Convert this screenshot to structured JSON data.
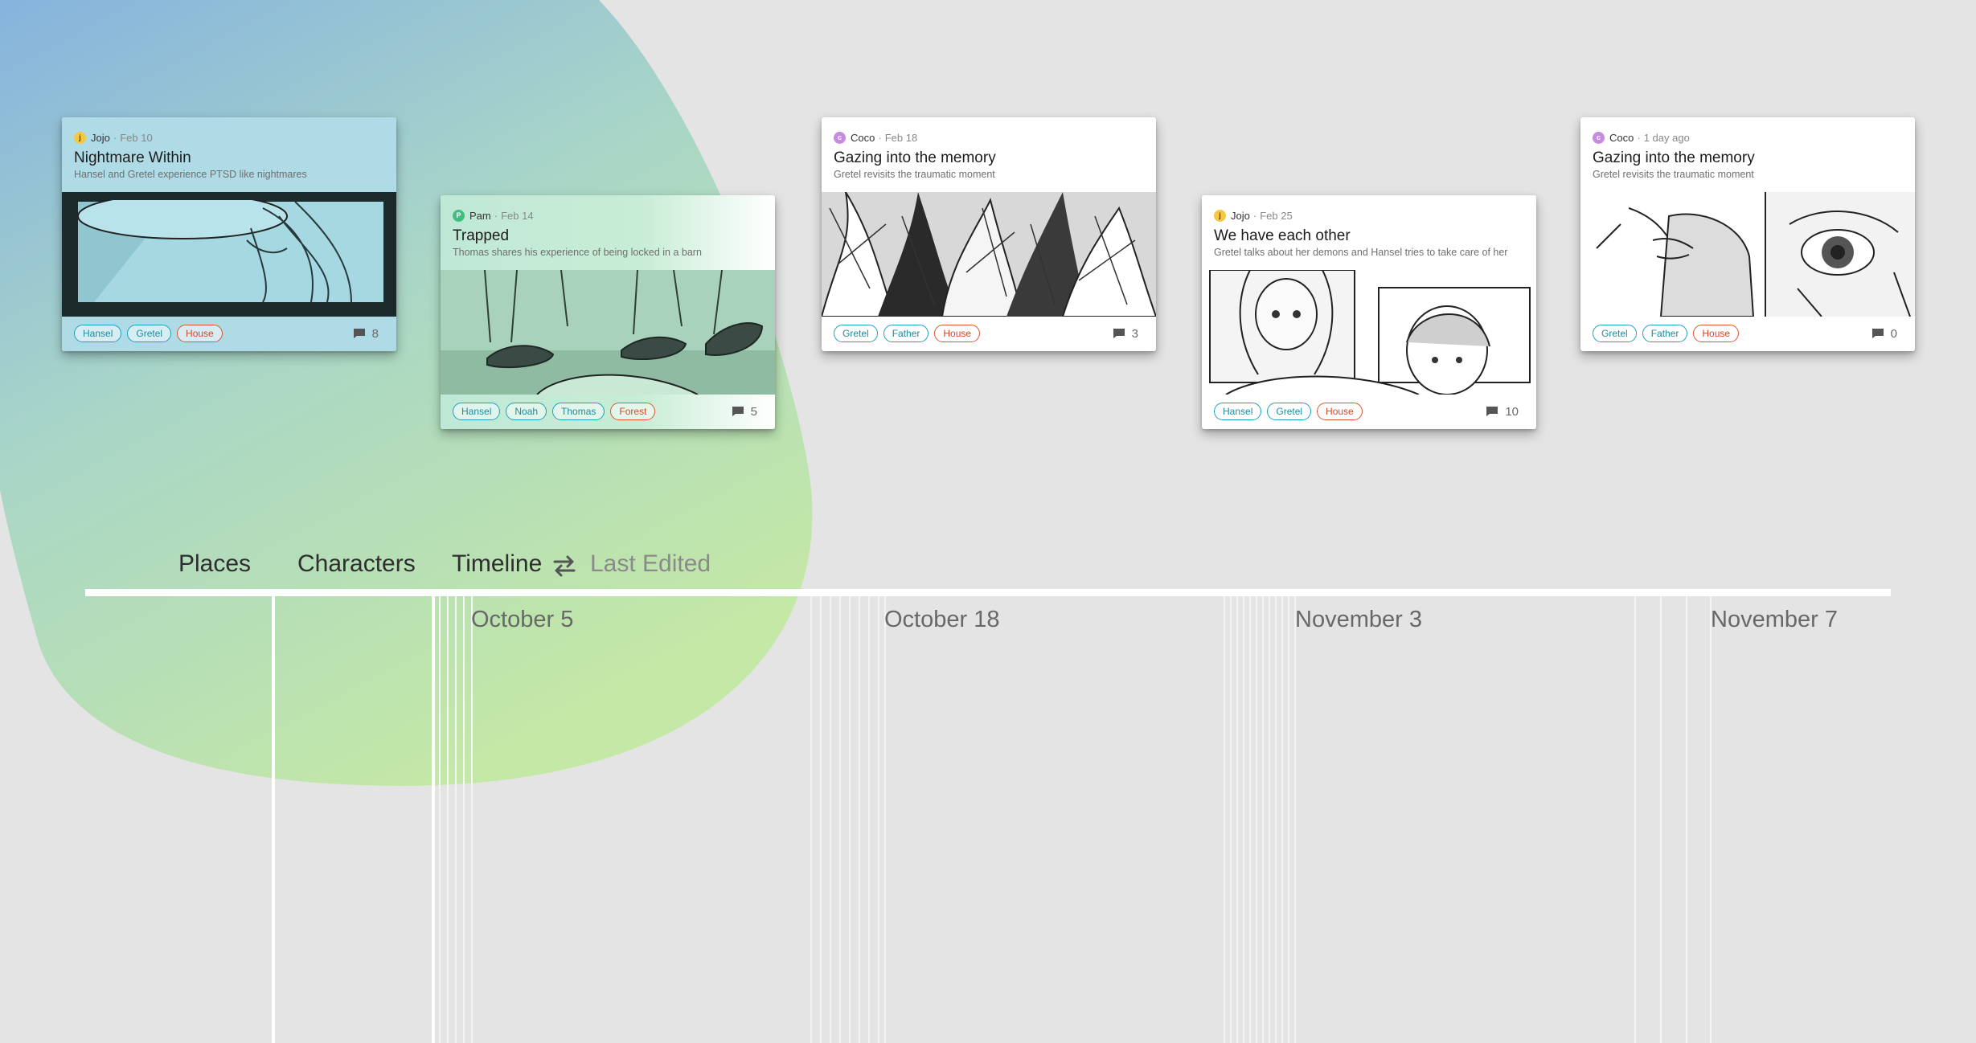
{
  "nav": {
    "places": "Places",
    "characters": "Characters",
    "timeline": "Timeline",
    "last_edited": "Last Edited",
    "swap_icon": "swap-arrows-icon"
  },
  "timeline_dates": [
    "October 5",
    "October 18",
    "November 3",
    "November 7"
  ],
  "cards": [
    {
      "author": "Jojo",
      "avatar_letter": "j",
      "avatar_color": "#f5c842",
      "date": "Feb 10",
      "title": "Nightmare Within",
      "subtitle": "Hansel and Gretel experience PTSD like nightmares",
      "tags": [
        "Hansel",
        "Gretel",
        "House"
      ],
      "comments": "8"
    },
    {
      "author": "Pam",
      "avatar_letter": "P",
      "avatar_color": "#3fbf7f",
      "date": "Feb 14",
      "title": "Trapped",
      "subtitle": "Thomas shares his experience of being locked in a barn",
      "tags": [
        "Hansel",
        "Noah",
        "Thomas",
        "Forest"
      ],
      "comments": "5"
    },
    {
      "author": "Coco",
      "avatar_letter": "c",
      "avatar_color": "#c68be0",
      "date": "Feb 18",
      "title": "Gazing into the memory",
      "subtitle": "Gretel revisits the traumatic moment",
      "tags": [
        "Gretel",
        "Father",
        "House"
      ],
      "comments": "3"
    },
    {
      "author": "Jojo",
      "avatar_letter": "j",
      "avatar_color": "#f5c842",
      "date": "Feb 25",
      "title": "We have each other",
      "subtitle": "Gretel talks about her demons and Hansel tries to take care of her",
      "tags": [
        "Hansel",
        "Gretel",
        "House"
      ],
      "comments": "10"
    },
    {
      "author": "Coco",
      "avatar_letter": "c",
      "avatar_color": "#c68be0",
      "date": "1 day ago",
      "title": "Gazing into the memory",
      "subtitle": "Gretel revisits the traumatic moment",
      "tags": [
        "Gretel",
        "Father",
        "House"
      ],
      "comments": "0"
    }
  ],
  "colors": {
    "tag_character": "#1aa3b8",
    "tag_place": "#e0552f",
    "blob_top": "#8cb8dc",
    "blob_bottom": "#c6e6a8"
  }
}
